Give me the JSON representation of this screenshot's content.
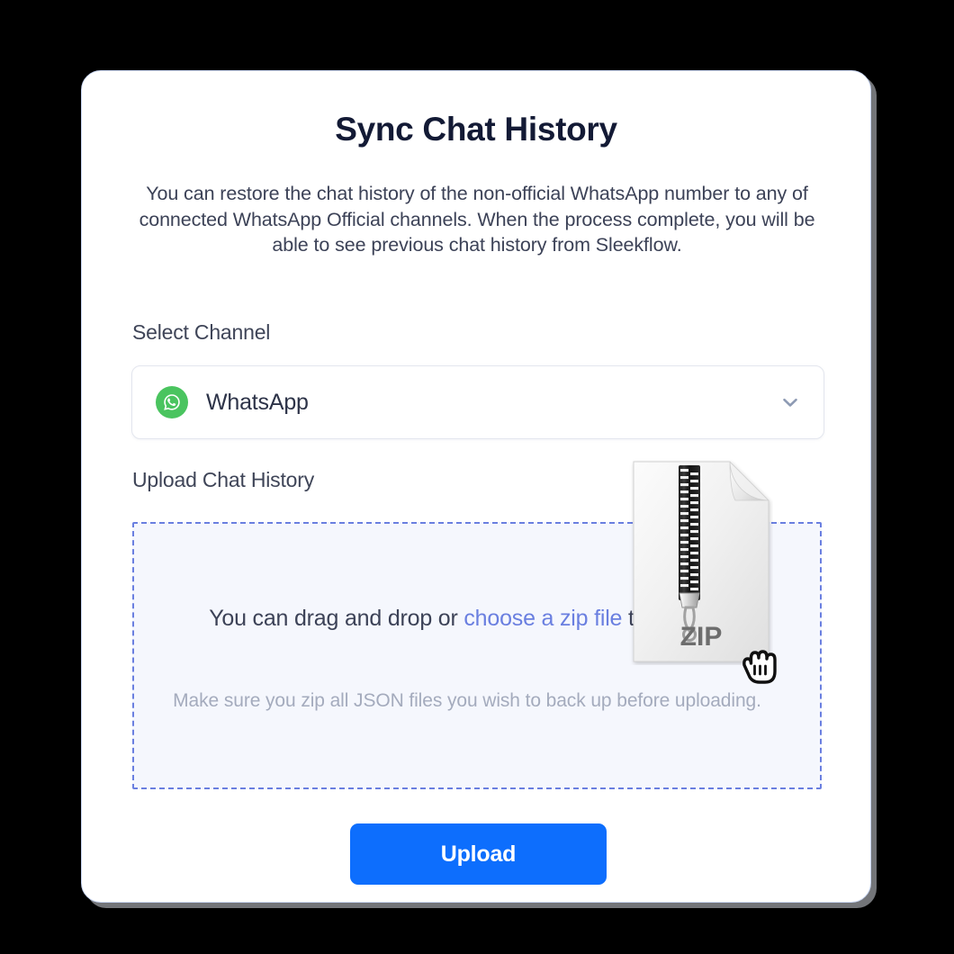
{
  "card": {
    "title": "Sync Chat History",
    "description": "You can restore the chat history of the non-official WhatsApp number to any of connected WhatsApp Official channels.  When the process complete, you will be able to see previous chat history from Sleekflow."
  },
  "select_channel": {
    "label": "Select Channel",
    "selected_value": "WhatsApp",
    "icon": "whatsapp-icon",
    "chevron": "chevron-down-icon"
  },
  "upload_section": {
    "label": "Upload Chat History",
    "dropzone": {
      "text_before_link": "You can drag and drop or ",
      "link_text": "choose a zip file",
      "text_after_link": " to upload.",
      "hint": "Make sure you zip all JSON files you wish to back up before uploading.",
      "file_icon_label": "ZIP",
      "file_icon": "zip-file-icon",
      "cursor_icon": "grabbing-hand-cursor-icon"
    }
  },
  "actions": {
    "upload_label": "Upload"
  },
  "colors": {
    "page_background": "#000000",
    "card_background": "#ffffff",
    "card_border": "#c9d6f2",
    "title_text": "#131a35",
    "body_text": "#3c4257",
    "muted_text": "#a4abbd",
    "accent_link": "#6a7fe0",
    "dropzone_border": "#6a7fe0",
    "dropzone_background": "#f5f7fd",
    "primary_button": "#0d6efd",
    "primary_button_text": "#ffffff",
    "whatsapp_green": "#4ac45f",
    "chevron": "#8d9ab3"
  }
}
